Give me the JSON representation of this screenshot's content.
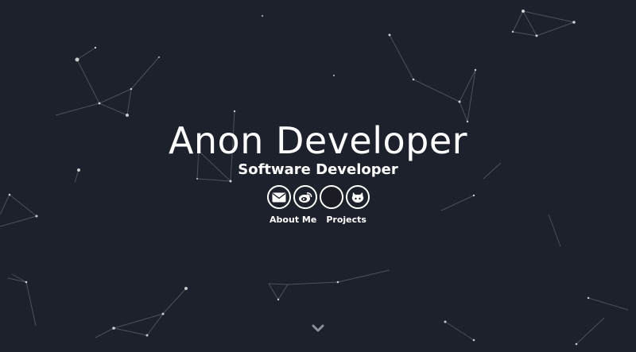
{
  "hero": {
    "name": "Anon Developer",
    "role": "Software Developer"
  },
  "social": [
    {
      "name": "email",
      "icon": "envelope-icon"
    },
    {
      "name": "weibo",
      "icon": "weibo-icon"
    },
    {
      "name": "blank",
      "icon": "circle-icon"
    },
    {
      "name": "github",
      "icon": "github-icon"
    }
  ],
  "nav": {
    "about": "About Me",
    "projects": "Projects"
  },
  "scroll": {
    "icon": "chevron-down-icon"
  },
  "colors": {
    "background": "#1c212b",
    "text": "#ffffff",
    "particle": "#ffffff"
  }
}
